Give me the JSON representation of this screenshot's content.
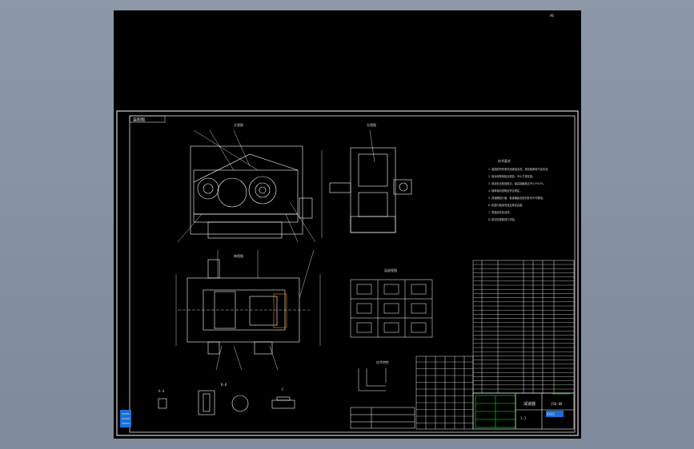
{
  "app": {
    "background_color": "#8c97a8",
    "canvas_color": "#000000",
    "line_color": "#ffffff",
    "accent_colors": {
      "title_block_highlight": "#00ff00",
      "layer_marker": "#1a6fd6",
      "dimension": "#00ffff"
    }
  },
  "drawing": {
    "frame_tag": "装配图",
    "top_right_mark": "A0",
    "tech_requirements_title": "技术要求",
    "tech_requirements": [
      "1. 装配前所有零件用煤油清洗，滚动轴承用汽油清洗。",
      "2. 啮合侧隙用铅丝检验，不小于规定值。",
      "3. 用涂色法检验斑点，齿高接触斑点不小于40%。",
      "4. 轴承轴向游隙应符合规定。",
      "5. 减速器剖分面、各接触面及密封处均不许漏油。",
      "6. 机座内装润滑油至规定高度。",
      "7. 表面涂灰色油漆。",
      "8. 按试验规程进行试验。"
    ],
    "views": {
      "front": "主视图",
      "side": "左视图",
      "top": "俯视图",
      "details": "局部视图",
      "section_a": "A-A",
      "section_b": "B-B",
      "section_c": "C"
    },
    "technical_characteristics_title": "技术特性",
    "title_block": {
      "drawing_name": "减速器",
      "scale": "1:2",
      "school": "XXXX",
      "code": "JSQ-00"
    }
  }
}
